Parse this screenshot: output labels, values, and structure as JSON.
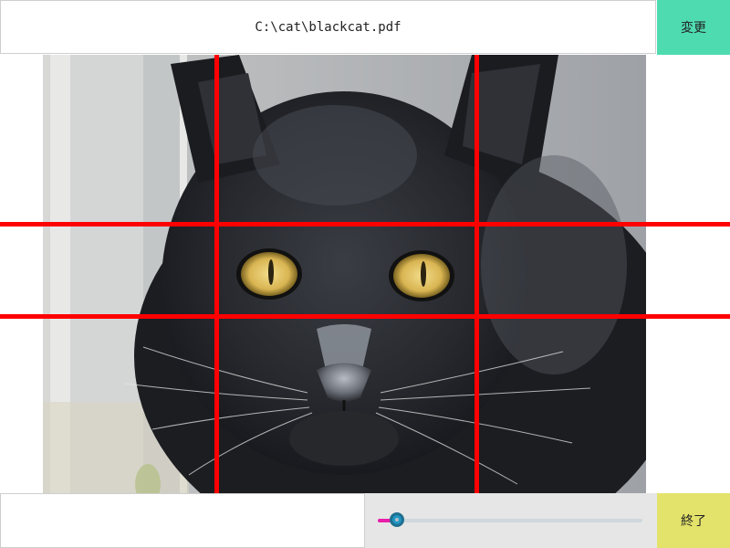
{
  "file": {
    "path": "C:\\cat\\blackcat.pdf"
  },
  "toolbar": {
    "change_label": "変更",
    "change_color": "#4edbb0"
  },
  "viewer": {
    "image_subject": "black cat portrait",
    "grid_color": "#ff0000"
  },
  "controls": {
    "slider_value": 0.06,
    "slider_fill_color": "#e91eaa",
    "quit_label": "終了",
    "quit_color": "#e3e36b"
  }
}
